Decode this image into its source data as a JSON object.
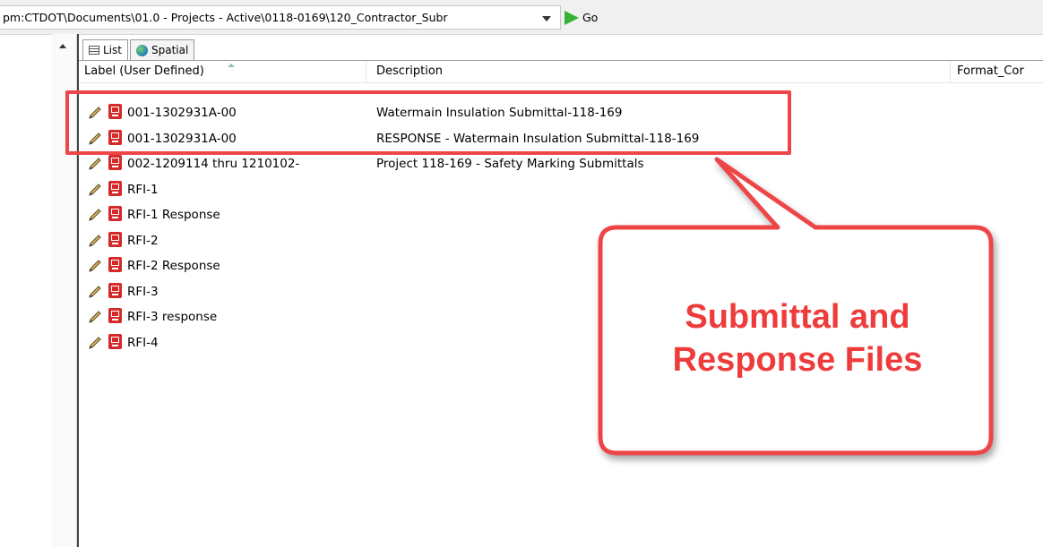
{
  "address": {
    "path": "pm:CTDOT\\Documents\\01.0 - Projects - Active\\0118-0169\\120_Contractor_Subr",
    "go_label": "Go"
  },
  "tabs": [
    {
      "label": "List",
      "icon": "list-icon",
      "active": true
    },
    {
      "label": "Spatial",
      "icon": "globe-icon",
      "active": false
    }
  ],
  "columns": {
    "label": "Label (User Defined)",
    "description": "Description",
    "format": "Format_Cor"
  },
  "rows": [
    {
      "name": "001-1302931A-00",
      "description": "Watermain Insulation Submittal-118-169"
    },
    {
      "name": "001-1302931A-00",
      "description": "RESPONSE - Watermain Insulation Submittal-118-169"
    },
    {
      "name": "002-1209114 thru 1210102-",
      "description": "Project 118-169 - Safety Marking Submittals"
    },
    {
      "name": "RFI-1",
      "description": ""
    },
    {
      "name": "RFI-1 Response",
      "description": ""
    },
    {
      "name": "RFI-2",
      "description": ""
    },
    {
      "name": "RFI-2 Response",
      "description": ""
    },
    {
      "name": "RFI-3",
      "description": ""
    },
    {
      "name": "RFI-3 response",
      "description": ""
    },
    {
      "name": "RFI-4",
      "description": ""
    }
  ],
  "callout": {
    "line1": "Submittal and",
    "line2": "Response Files"
  },
  "colors": {
    "annotation": "#ee4546",
    "go_arrow": "#34b233",
    "pdf_icon": "#d42a2a"
  }
}
